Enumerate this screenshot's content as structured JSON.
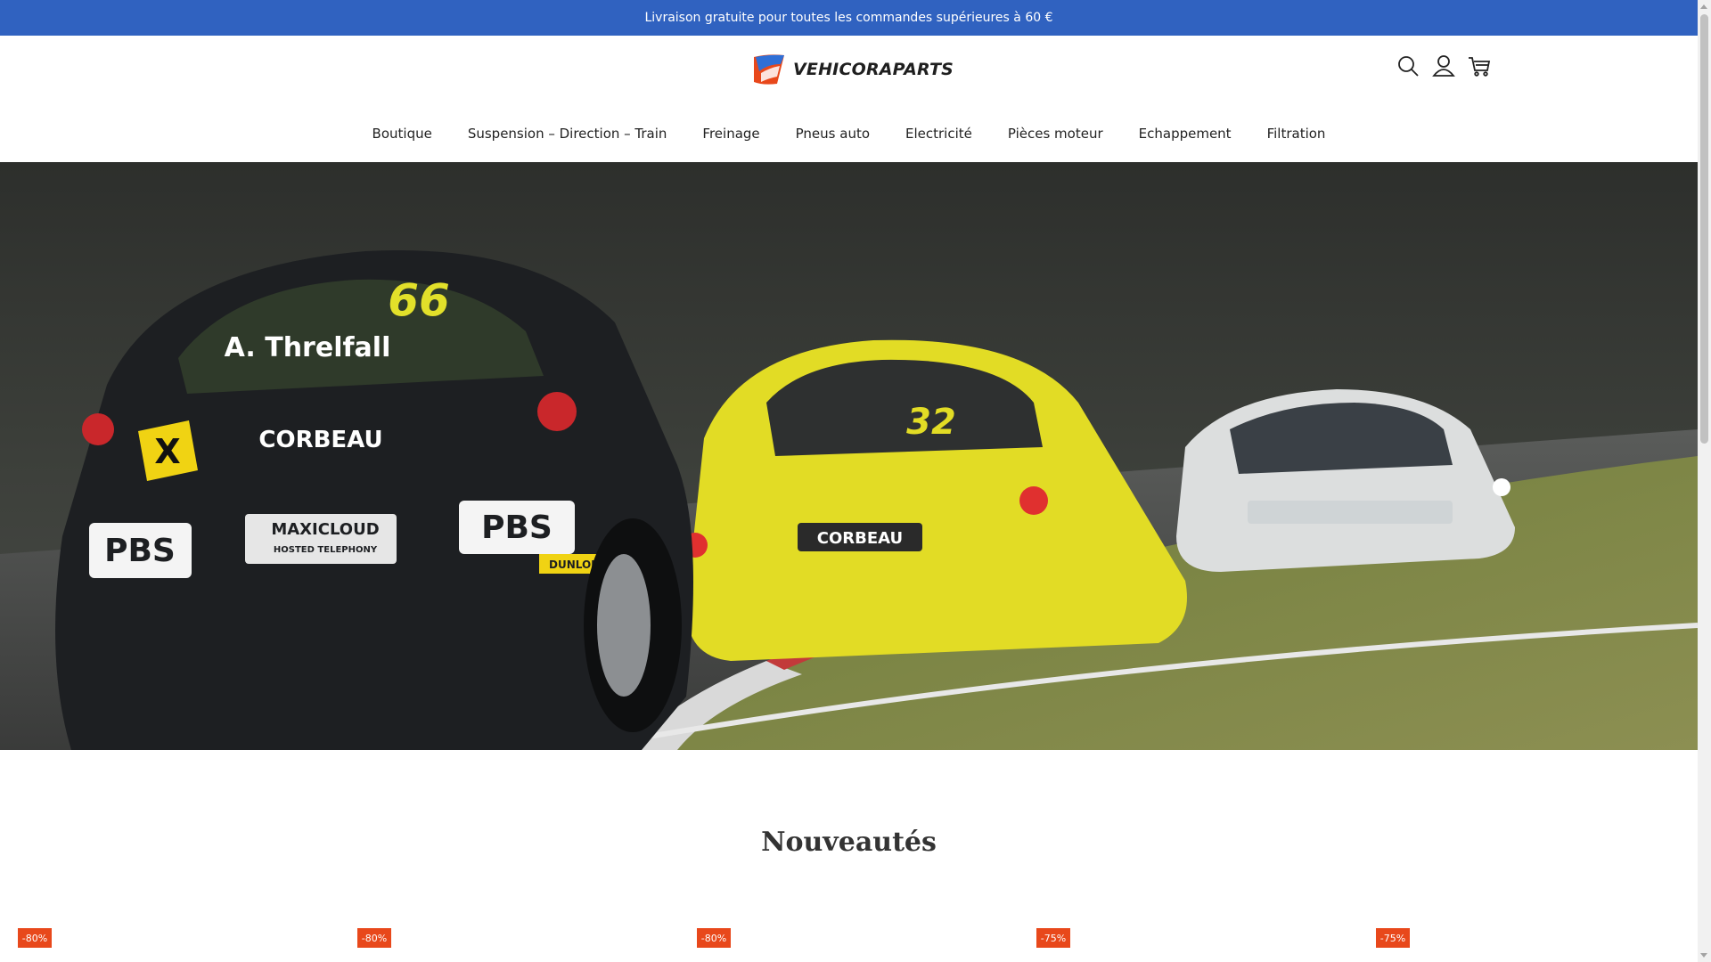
{
  "announcement": {
    "text": "Livraison gratuite pour toutes les commandes supérieures à 60 €"
  },
  "header": {
    "logo_text": "VEHICORAPARTS",
    "icons": [
      "search-icon",
      "account-icon",
      "cart-icon"
    ]
  },
  "nav": {
    "items": [
      {
        "label": "Boutique"
      },
      {
        "label": "Suspension – Direction – Train"
      },
      {
        "label": "Freinage"
      },
      {
        "label": "Pneus auto"
      },
      {
        "label": "Electricité"
      },
      {
        "label": "Pièces moteur"
      },
      {
        "label": "Echappement"
      },
      {
        "label": "Filtration"
      }
    ]
  },
  "hero": {
    "car1_number": "66",
    "car1_driver": "A. Threlfall",
    "car2_number": "32",
    "sponsor_texts": [
      "CORBEAU",
      "PBS",
      "MAXICLOUD",
      "HOSTED TELEPHONY",
      "DUNLOP"
    ]
  },
  "section": {
    "title": "Nouveautés"
  },
  "products": [
    {
      "discount": "-80%"
    },
    {
      "discount": "-80%"
    },
    {
      "discount": "-80%"
    },
    {
      "discount": "-75%"
    },
    {
      "discount": "-75%"
    }
  ],
  "colors": {
    "announcement_bg": "#3062c0",
    "badge_bg": "#e8481b"
  }
}
